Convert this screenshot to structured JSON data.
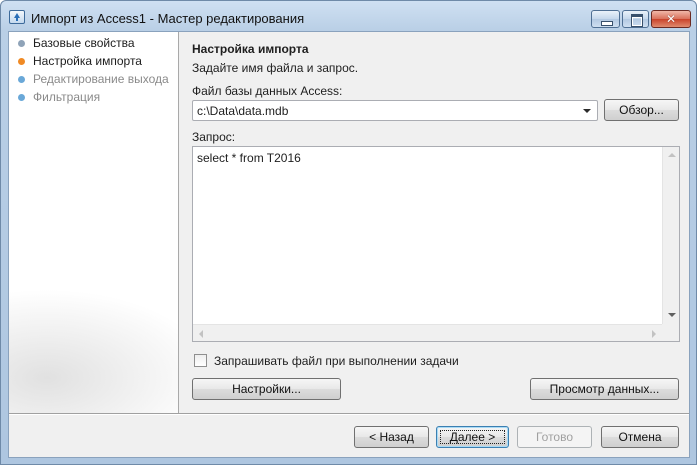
{
  "window": {
    "title": "Импорт из Access1 - Мастер редактирования",
    "close_glyph": "✕"
  },
  "steps": [
    {
      "label": "Базовые свойства",
      "state": "done",
      "color": "#8fa3b8"
    },
    {
      "label": "Настройка импорта",
      "state": "current",
      "color": "#f08a24"
    },
    {
      "label": "Редактирование выхода",
      "state": "pending",
      "color": "#6aa8d8"
    },
    {
      "label": "Фильтрация",
      "state": "pending",
      "color": "#6aa8d8"
    }
  ],
  "page": {
    "heading": "Настройка импорта",
    "subtitle": "Задайте имя файла и запрос.",
    "file_label": "Файл базы данных Access:",
    "file_value": "c:\\Data\\data.mdb",
    "browse_label": "Обзор...",
    "query_label": "Запрос:",
    "query_value": "select * from T2016",
    "ask_file_label": "Запрашивать файл при выполнении задачи",
    "ask_file_checked": false,
    "settings_label": "Настройки...",
    "preview_label": "Просмотр данных..."
  },
  "footer": {
    "back_label": "< Назад",
    "next_label": "Далее >",
    "finish_label": "Готово",
    "cancel_label": "Отмена"
  }
}
